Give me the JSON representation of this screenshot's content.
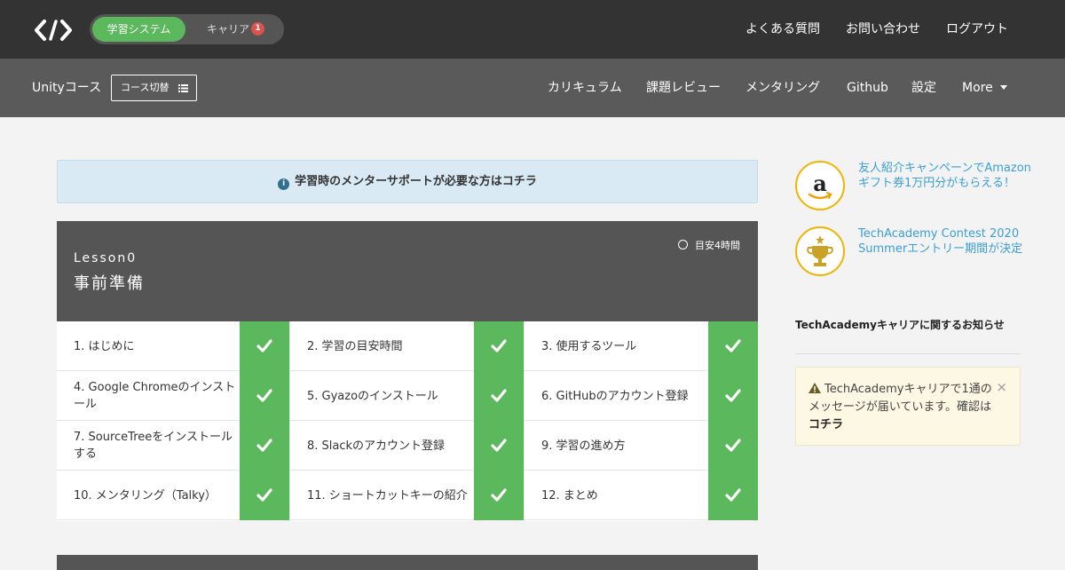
{
  "header": {
    "tabs": [
      {
        "label": "学習システム",
        "active": true
      },
      {
        "label": "キャリア",
        "badge": "1"
      }
    ],
    "links": [
      "よくある質問",
      "お問い合わせ",
      "ログアウト"
    ]
  },
  "subnav": {
    "course_name": "Unityコース",
    "course_switch": "コース切替",
    "items": [
      "カリキュラム",
      "課題レビュー",
      "メンタリング",
      "Github",
      "設定"
    ],
    "more": "More"
  },
  "banner": {
    "text": "学習時のメンターサポートが必要な方はコチラ"
  },
  "lesson": {
    "number": "Lesson0",
    "title": "事前準備",
    "time": "目安4時間",
    "items": [
      {
        "label": "1. はじめに",
        "done": true
      },
      {
        "label": "2. 学習の目安時間",
        "done": true
      },
      {
        "label": "3. 使用するツール",
        "done": true
      },
      {
        "label": "4. Google Chromeのインストール",
        "done": true
      },
      {
        "label": "5. Gyazoのインストール",
        "done": true
      },
      {
        "label": "6. GitHubのアカウント登録",
        "done": true
      },
      {
        "label": "7. SourceTreeをインストールする",
        "done": true
      },
      {
        "label": "8. Slackのアカウント登録",
        "done": true
      },
      {
        "label": "9. 学習の進め方",
        "done": true
      },
      {
        "label": "10. メンタリング（Talky）",
        "done": true
      },
      {
        "label": "11. ショートカットキーの紹介",
        "done": true
      },
      {
        "label": "12. まとめ",
        "done": true
      }
    ]
  },
  "sidebar": {
    "promos": [
      {
        "text": "友人紹介キャンペーンでAmazonギフト券1万円分がもらえる！",
        "icon": "amazon-icon"
      },
      {
        "text": "TechAcademy Contest 2020 Summerエントリー期間が決定",
        "icon": "trophy-icon"
      }
    ],
    "career_title": "TechAcademyキャリアに関するお知らせ",
    "alert": {
      "text": "TechAcademyキャリアで1通のメッセージが届いています。確認は",
      "link": "コチラ",
      "close": "×"
    }
  },
  "colors": {
    "accent": "#5cb85c",
    "header": "#333333",
    "subnav": "#5a5a5a",
    "link": "#3a9fd6"
  }
}
